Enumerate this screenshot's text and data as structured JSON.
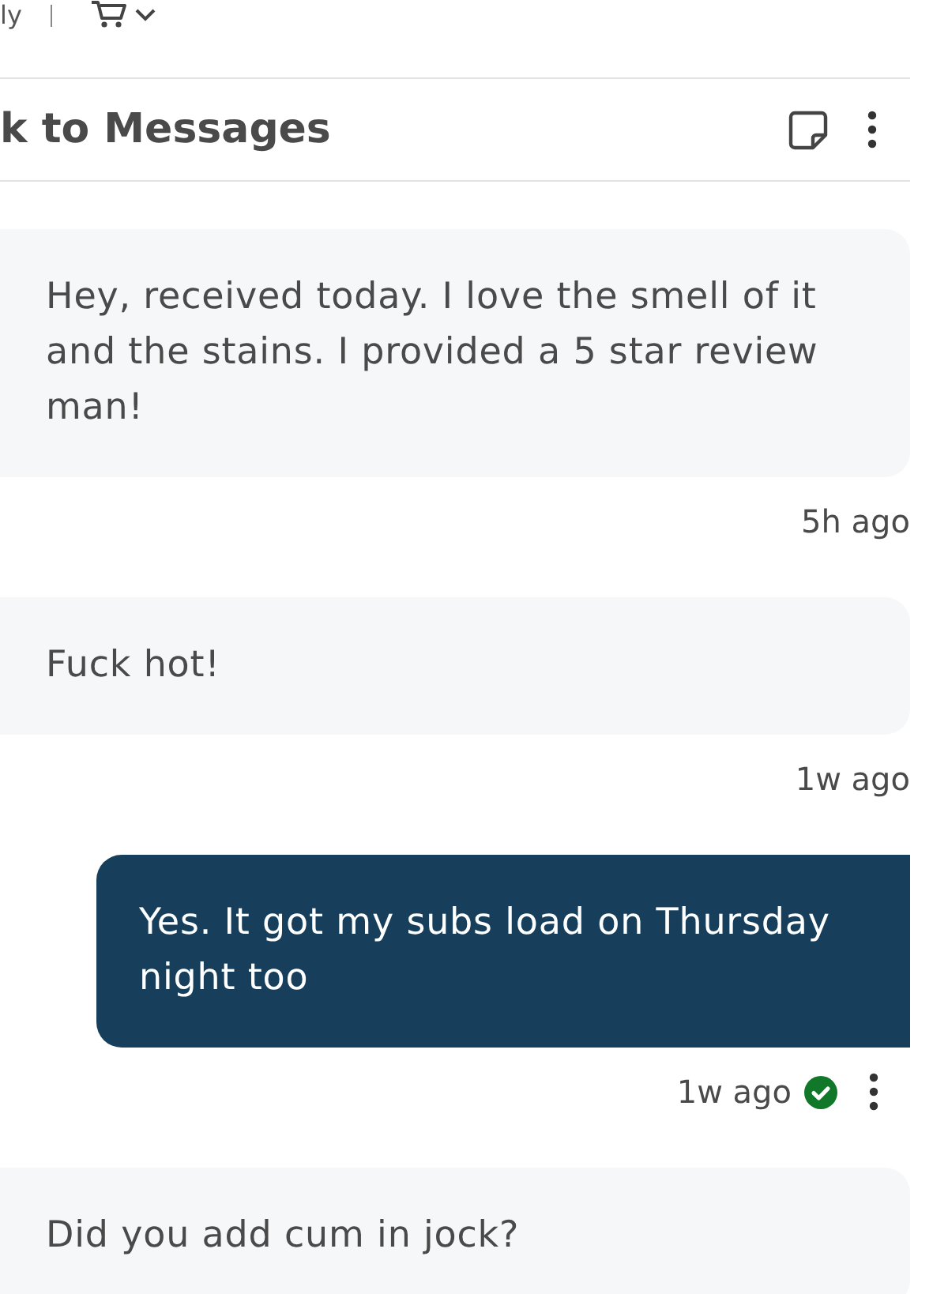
{
  "top_bar": {
    "partial_label": "ly"
  },
  "header": {
    "title": "k to Messages"
  },
  "messages": [
    {
      "kind": "received",
      "text": "Hey, received today. I love the smell of it and the stains. I provided a 5 star review man!",
      "time": "5h ago"
    },
    {
      "kind": "received",
      "text": "Fuck hot!",
      "time": "1w ago"
    },
    {
      "kind": "sent",
      "text": "Yes. It got my subs load on Thursday night too",
      "time": "1w ago",
      "read": true
    },
    {
      "kind": "received",
      "text": "Did you add cum in jock?"
    }
  ]
}
